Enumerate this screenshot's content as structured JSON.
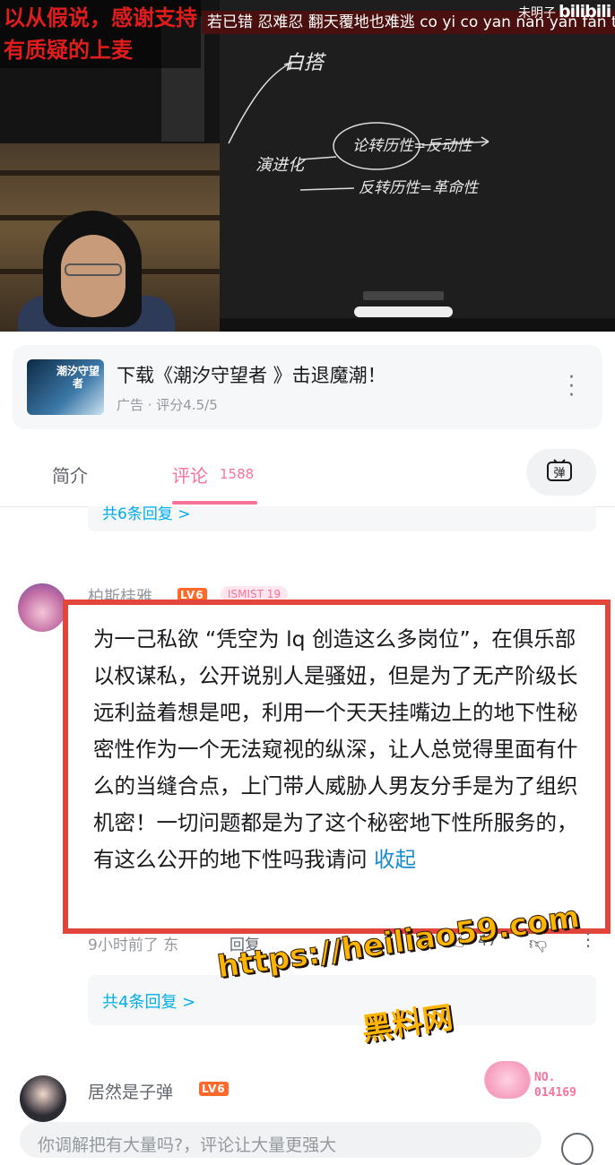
{
  "video": {
    "overlay_text_line1": "以从假说，感谢支持",
    "overlay_text_line2": "有质疑的上麦",
    "subtitle_line": "若已错 忍难忍 翻天覆地也难逃 co yi co yan nan yan fan tin fu dei y",
    "uploader": "未明子",
    "brand": "bilibili",
    "board_notes": [
      "白搭",
      "演进化",
      "论转历性=反动性",
      "反转历性=革命性"
    ]
  },
  "ad": {
    "thumb_text": "潮汐守望者",
    "title": "下载《潮汐守望者 》击退魔潮！",
    "subtitle": "广告 · 评分4.5/5",
    "more_icon": "more-vertical-icon"
  },
  "tabs": {
    "intro_label": "简介",
    "comment_label": "评论",
    "comment_count": "1588",
    "danmu_icon": "danmaku-icon",
    "danmu_glyph": "弹"
  },
  "comments": {
    "prev_reply_link": "共6条回复 >",
    "c1": {
      "username": "柏斯桂雅",
      "level": "LV6",
      "medal": "ISMIST 19",
      "text": "为一己私欲 “凭空为 lq 创造这么多岗位”，在俱乐部以权谋私，公开说别人是骚妞，但是为了无产阶级长远利益着想是吧，利用一个天天挂嘴边上的地下性秘密性作为一个无法窥视的纵深，让人总觉得里面有什么的当缝合点，上门带人威胁人男友分手是为了组织机密！一切问题都是为了这个秘密地下性所服务的，有这么公开的地下性吗我请问",
      "collapse_label": "收起",
      "meta": "9小时前了 东",
      "reply_label": "回复",
      "likes": "47",
      "reply_link": "共4条回复 >"
    },
    "c2": {
      "username": "居然是子弹",
      "level": "LV6",
      "deco_number_line1": "NO.",
      "deco_number_line2": "014169"
    }
  },
  "watermark": {
    "line1": "https://heiliao59.com",
    "line2": "黑料网"
  },
  "input": {
    "placeholder": "你调解把有大量吗?，评论让大量更强大"
  },
  "colors": {
    "accent_pink": "#fb7299",
    "link_blue": "#00aeec",
    "highlight_red": "#e2463b"
  }
}
